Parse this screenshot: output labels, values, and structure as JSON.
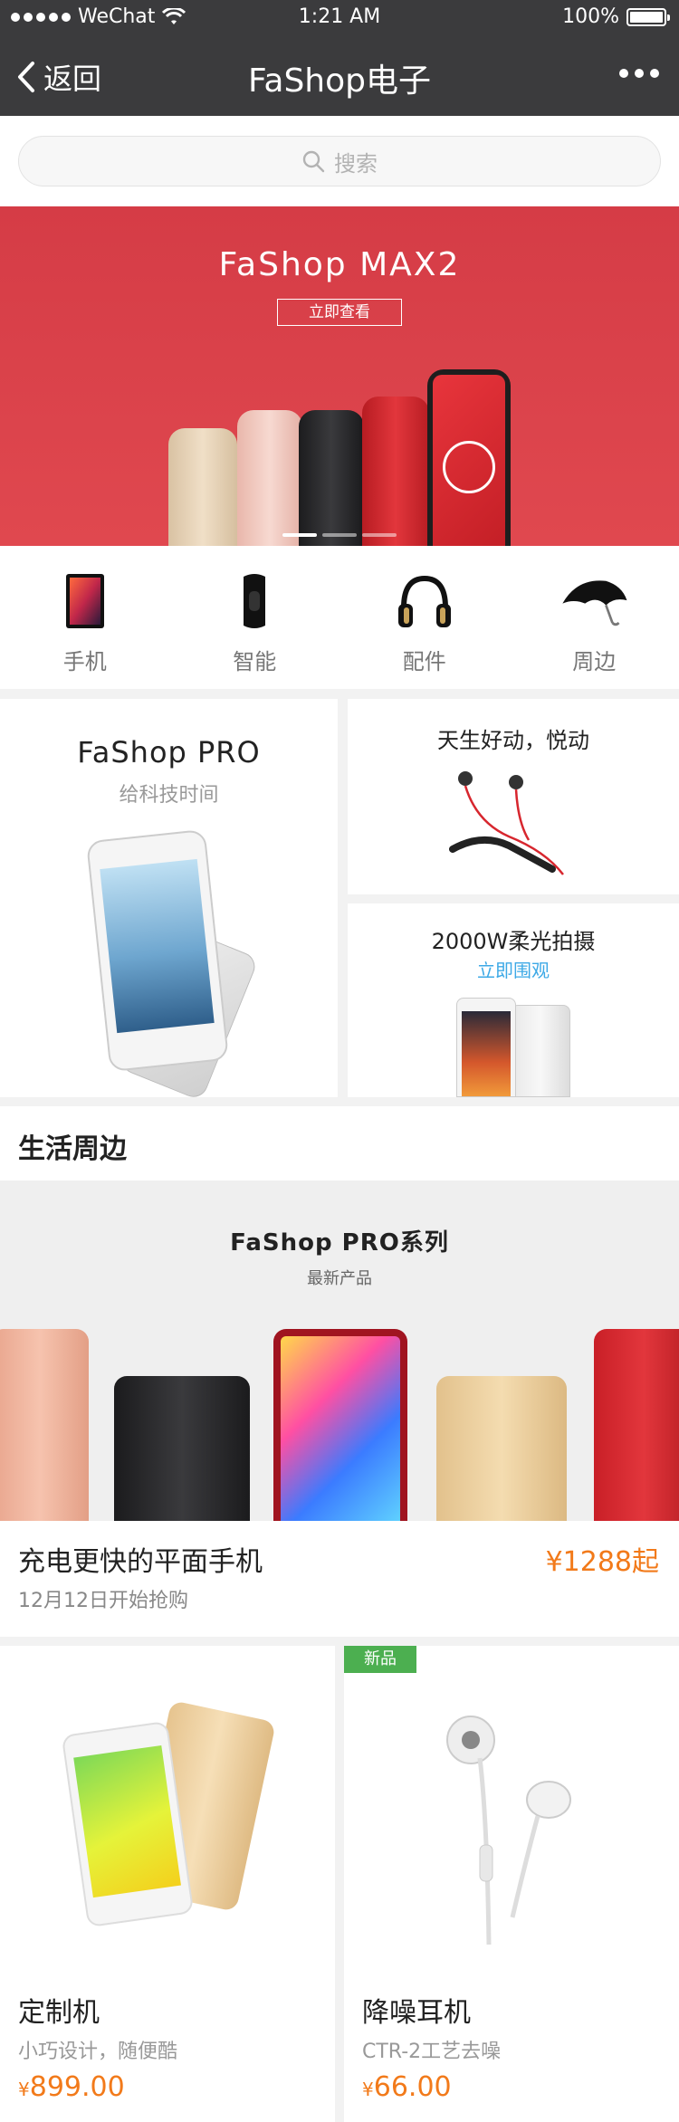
{
  "status_bar": {
    "carrier": "WeChat",
    "time": "1:21 AM",
    "battery": "100%"
  },
  "nav": {
    "back_label": "返回",
    "title": "FaShop电子"
  },
  "search": {
    "placeholder": "搜索"
  },
  "banner": {
    "title": "FaShop MAX2",
    "button_label": "立即查看",
    "slides_total": 3,
    "active_slide": 1,
    "phone_colors": [
      "#e8d2b4",
      "#f1c7bd",
      "#2a2a2c",
      "#d7262e",
      "#e22b31"
    ]
  },
  "categories": [
    {
      "label": "手机",
      "icon": "phone-icon"
    },
    {
      "label": "智能",
      "icon": "band-icon"
    },
    {
      "label": "配件",
      "icon": "headphones-icon"
    },
    {
      "label": "周边",
      "icon": "umbrella-icon"
    }
  ],
  "promos": {
    "big": {
      "title": "FaShop PRO",
      "subtitle": "给科技时间"
    },
    "small1": {
      "title": "天生好动，悦动"
    },
    "small2": {
      "title": "2000W柔光拍摄",
      "link": "立即围观"
    }
  },
  "section": {
    "title": "生活周边"
  },
  "feature": {
    "title": "FaShop PRO系列",
    "subtitle": "最新产品",
    "name": "充电更快的平面手机",
    "price": "¥1288起",
    "sub": "12月12日开始抢购"
  },
  "products": [
    {
      "name": "定制机",
      "sub": "小巧设计，随便酷",
      "currency": "¥",
      "price": "899.00",
      "badge": ""
    },
    {
      "name": "降噪耳机",
      "sub": "CTR-2工艺去噪",
      "currency": "¥",
      "price": "66.00",
      "badge": "新品"
    }
  ],
  "colors": {
    "topbar": "#3b3b3d",
    "banner": "#e0484f",
    "price": "#f27a1a",
    "link": "#3da9e6",
    "badge": "#4caf50"
  }
}
